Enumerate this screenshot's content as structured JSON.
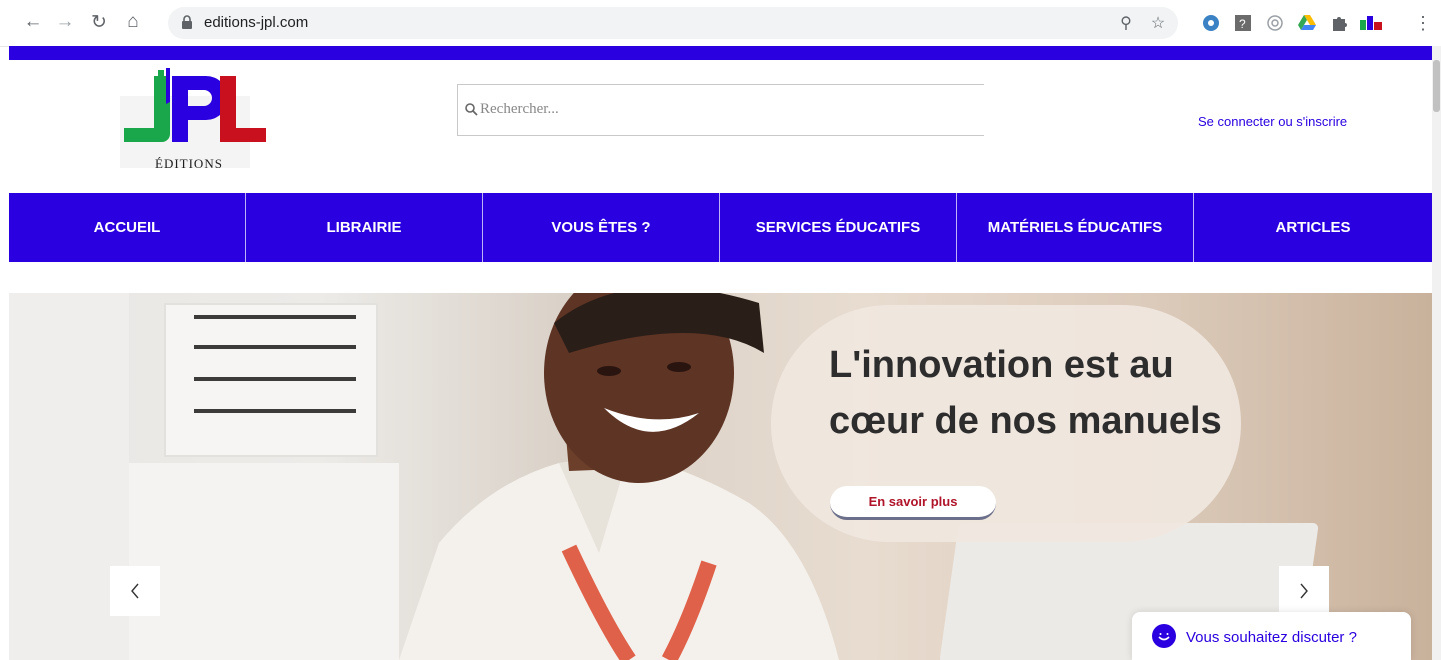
{
  "browser": {
    "url": "editions-jpl.com"
  },
  "header": {
    "logo_text": "ÉDITIONS",
    "search_placeholder": "Rechercher...",
    "login_label": "Se connecter ou s'inscrire"
  },
  "nav": {
    "items": [
      "ACCUEIL",
      "LIBRAIRIE",
      "VOUS ÊTES ?",
      "SERVICES ÉDUCATIFS",
      "MATÉRIELS ÉDUCATIFS",
      "ARTICLES"
    ]
  },
  "hero": {
    "headline": "L'innovation est au cœur de nos manuels",
    "cta_label": "En savoir plus",
    "prev_icon": "chevron-left-icon",
    "next_icon": "chevron-right-icon"
  },
  "chat": {
    "label": "Vous souhaitez discuter ?"
  },
  "colors": {
    "brand_blue": "#2a00e0",
    "logo_green": "#1aa64a",
    "logo_red": "#c8101e",
    "cta_text": "#b0142a"
  }
}
